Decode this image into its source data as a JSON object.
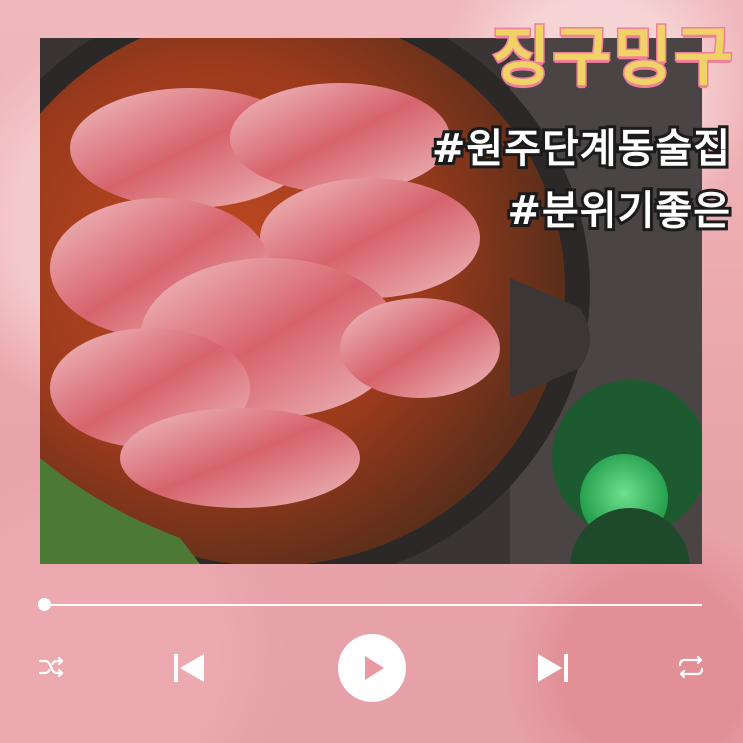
{
  "header": {
    "title": "징구밍구",
    "hashtags": [
      "#원주단계동술집",
      "#분위기좋은"
    ]
  },
  "player": {
    "progress": 0.0,
    "controls": [
      "shuffle-icon",
      "previous-icon",
      "play-icon",
      "next-icon",
      "repeat-icon"
    ]
  },
  "colors": {
    "title_fill": "#f1d266",
    "title_outline": "#ef7f9a",
    "background": "#e9a7ad",
    "controls": "#ffffff"
  }
}
